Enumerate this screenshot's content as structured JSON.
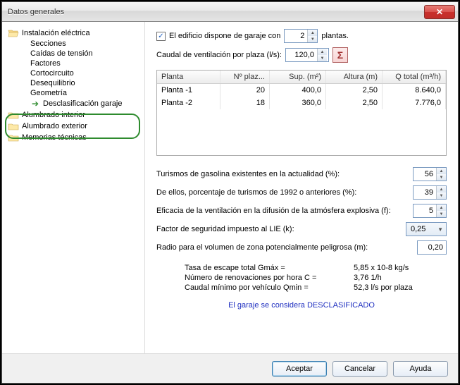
{
  "window": {
    "title": "Datos generales"
  },
  "tree": {
    "root1": "Instalación eléctrica",
    "children1": [
      "Secciones",
      "Caídas de tensión",
      "Factores",
      "Cortocircuito",
      "Desequilibrio",
      "Geometría",
      "Desclasificación garaje"
    ],
    "root2": "Alumbrado interior",
    "root3": "Alumbrado exterior",
    "root4": "Memorias técnicas"
  },
  "form": {
    "garage_check_label": "El edificio dispone de garaje con",
    "plantas_value": "2",
    "plantas_suffix": "plantas.",
    "caudal_label": "Caudal de ventilación por plaza (l/s):",
    "caudal_value": "120,0",
    "table": {
      "headers": [
        "Planta",
        "Nº plaz...",
        "Sup. (m²)",
        "Altura (m)",
        "Q total (m³/h)"
      ],
      "rows": [
        [
          "Planta -1",
          "20",
          "400,0",
          "2,50",
          "8.640,0"
        ],
        [
          "Planta -2",
          "18",
          "360,0",
          "2,50",
          "7.776,0"
        ]
      ]
    },
    "turismos_label": "Turismos de gasolina existentes en la actualidad (%):",
    "turismos_value": "56",
    "deellos_label": "De ellos, porcentaje de turismos de 1992 o anteriores (%):",
    "deellos_value": "39",
    "eficacia_label": "Eficacia de la ventilación en la difusión de la atmósfera explosiva (f):",
    "eficacia_value": "5",
    "factork_label": "Factor de seguridad impuesto al LIE (k):",
    "factork_value": "0,25",
    "radio_label": "Radio para el volumen de zona potencialmente peligrosa (m):",
    "radio_value": "0,20",
    "results": {
      "r1_label": "Tasa de escape total Gmáx =",
      "r1_value": "5,85 x 10-8 kg/s",
      "r2_label": "Número de renovaciones por hora C =",
      "r2_value": "3,76 1/h",
      "r3_label": "Caudal mínimo por vehículo Qmin =",
      "r3_value": "52,3 l/s por plaza"
    },
    "status": "El garaje se considera DESCLASIFICADO"
  },
  "buttons": {
    "ok": "Aceptar",
    "cancel": "Cancelar",
    "help": "Ayuda"
  }
}
